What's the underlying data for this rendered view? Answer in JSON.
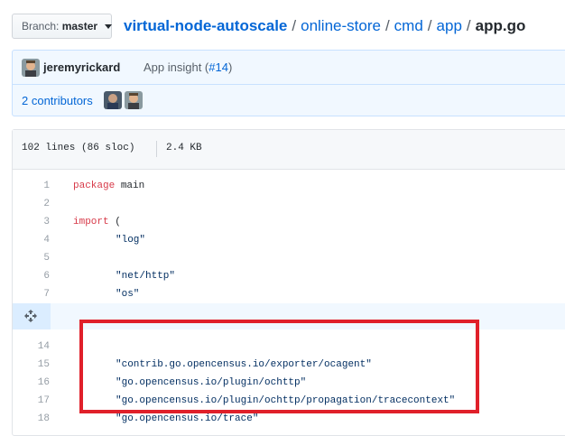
{
  "branch": {
    "label": "Branch:",
    "value": "master"
  },
  "breadcrumb": {
    "repo": "virtual-node-autoscale",
    "parts": [
      "online-store",
      "cmd",
      "app"
    ],
    "file": "app.go",
    "separator": "/"
  },
  "commit": {
    "author": "jeremyrickard",
    "message": "App insight (",
    "pr": "#14",
    "close": ")",
    "contributors": "2 contributors"
  },
  "file": {
    "lines_info": "102 lines (86 sloc)",
    "size": "2.4 KB"
  },
  "code_top": [
    {
      "n": "1",
      "kw": "package",
      "rest": " main"
    },
    {
      "n": "2",
      "kw": "",
      "rest": ""
    },
    {
      "n": "3",
      "kw": "import",
      "rest": " ("
    },
    {
      "n": "4",
      "kw": "",
      "rest": "\t\"log\""
    },
    {
      "n": "5",
      "kw": "",
      "rest": ""
    },
    {
      "n": "6",
      "kw": "",
      "rest": "\t\"net/http\""
    },
    {
      "n": "7",
      "kw": "",
      "rest": "\t\"os\""
    }
  ],
  "code_bottom": [
    {
      "n": "14",
      "kw": "",
      "rest": ""
    },
    {
      "n": "15",
      "kw": "",
      "rest": "\t\"contrib.go.opencensus.io/exporter/ocagent\""
    },
    {
      "n": "16",
      "kw": "",
      "rest": "\t\"go.opencensus.io/plugin/ochttp\""
    },
    {
      "n": "17",
      "kw": "",
      "rest": "\t\"go.opencensus.io/plugin/ochttp/propagation/tracecontext\""
    },
    {
      "n": "18",
      "kw": "",
      "rest": "\t\"go.opencensus.io/trace\""
    }
  ],
  "colors": {
    "link": "#0366d6",
    "keyword": "#d73a49",
    "string": "#032f62",
    "highlight": "#e0202a"
  },
  "icons": {
    "expand": "unfold-icon",
    "caret": "chevron-down-icon"
  }
}
